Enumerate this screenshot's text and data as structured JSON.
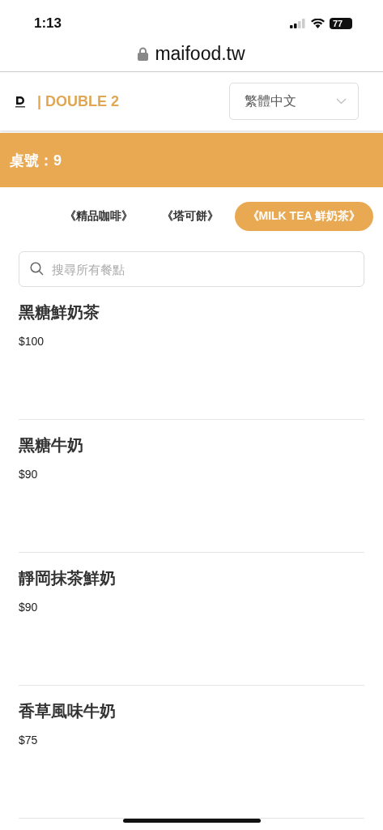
{
  "status_bar": {
    "time": "1:13",
    "battery": "77"
  },
  "address_bar": {
    "url": "maifood.tw"
  },
  "header": {
    "brand": "| DOUBLE 2",
    "language": "繁體中文"
  },
  "banner": {
    "table": "桌號：9"
  },
  "tabs": [
    {
      "label": "《精品咖啡》",
      "selected": false
    },
    {
      "label": "《塔可餅》",
      "selected": false
    },
    {
      "label": "《MILK TEA 鮮奶茶》",
      "selected": true
    }
  ],
  "search": {
    "placeholder": "搜尋所有餐點"
  },
  "menu_items": [
    {
      "name": "黑糖鮮奶茶",
      "price": "$100"
    },
    {
      "name": "黑糖牛奶",
      "price": "$90"
    },
    {
      "name": "靜岡抹茶鮮奶",
      "price": "$90"
    },
    {
      "name": "香草風味牛奶",
      "price": "$75"
    }
  ]
}
